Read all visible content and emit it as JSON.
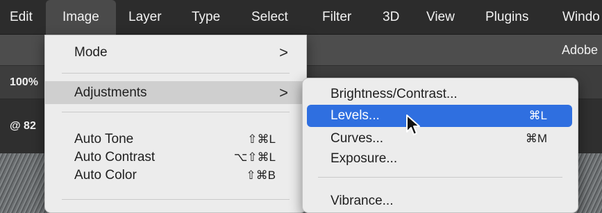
{
  "menubar": {
    "items": [
      {
        "label": "Edit"
      },
      {
        "label": "Image"
      },
      {
        "label": "Layer"
      },
      {
        "label": "Type"
      },
      {
        "label": "Select"
      },
      {
        "label": "Filter"
      },
      {
        "label": "3D"
      },
      {
        "label": "View"
      },
      {
        "label": "Plugins"
      },
      {
        "label": "Windo"
      }
    ],
    "active": "Image"
  },
  "options_bar": {
    "app_label": "Adobe"
  },
  "toolbar_row": {
    "zoom": "100%"
  },
  "document_tab": {
    "zoom_label": "@ 82"
  },
  "image_menu": {
    "items": [
      {
        "label": "Mode",
        "submenu": true
      },
      {
        "label": "Adjustments",
        "submenu": true,
        "highlighted": true
      },
      {
        "label": "Auto Tone",
        "shortcut": "⇧⌘L"
      },
      {
        "label": "Auto Contrast",
        "shortcut": "⌥⇧⌘L"
      },
      {
        "label": "Auto Color",
        "shortcut": "⇧⌘B"
      }
    ],
    "submenu_arrow": ">"
  },
  "adjustments_menu": {
    "items": [
      {
        "label": "Brightness/Contrast..."
      },
      {
        "label": "Levels...",
        "shortcut": "⌘L",
        "highlighted": true
      },
      {
        "label": "Curves...",
        "shortcut": "⌘M"
      },
      {
        "label": "Exposure..."
      },
      {
        "label": "Vibrance..."
      }
    ]
  },
  "colors": {
    "selection_blue": "#2f6fe0",
    "menu_bg": "#ececec",
    "menubar_bg": "#2c2c2c"
  },
  "icons": {
    "cursor": "arrow-pointer-icon"
  }
}
